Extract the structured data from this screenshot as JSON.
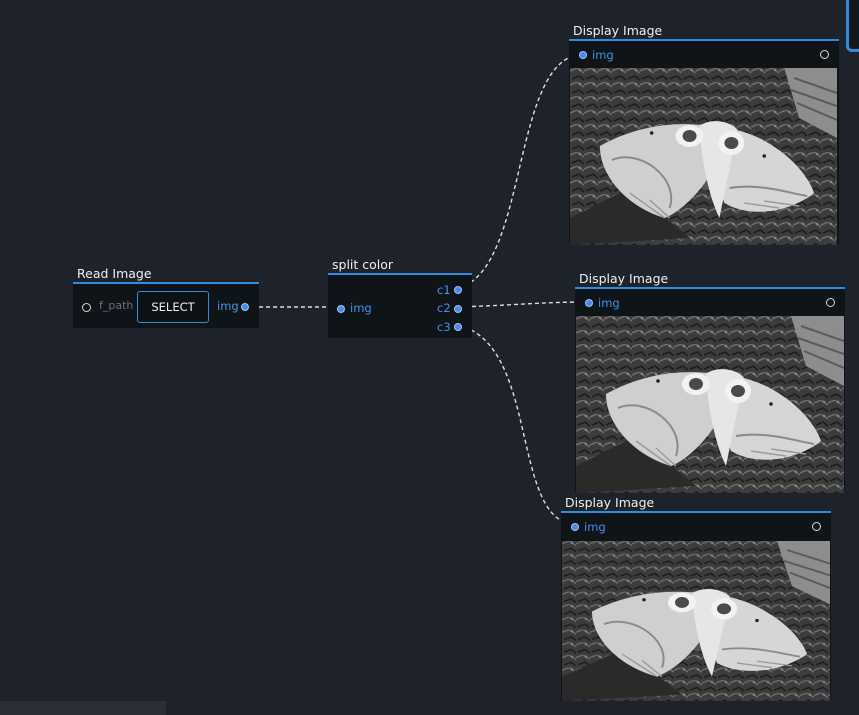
{
  "nodes": {
    "read_image": {
      "title": "Read Image",
      "input_label": "f_path",
      "button_label": "SELECT",
      "output_label": "img"
    },
    "split_color": {
      "title": "split color",
      "input_label": "img",
      "outputs": [
        "c1",
        "c2",
        "c3"
      ]
    },
    "display_1": {
      "title": "Display Image",
      "input_label": "img"
    },
    "display_2": {
      "title": "Display Image",
      "input_label": "img"
    },
    "display_3": {
      "title": "Display Image",
      "input_label": "img"
    }
  },
  "colors": {
    "canvas_bg": "#1e222a",
    "node_bg": "#0f1419",
    "accent": "#2f8ddf",
    "port_label": "#3b95e8",
    "wire": "#e0e0e0"
  },
  "icons": {
    "input_port": "hollow-circle",
    "output_port": "filled-circle"
  }
}
